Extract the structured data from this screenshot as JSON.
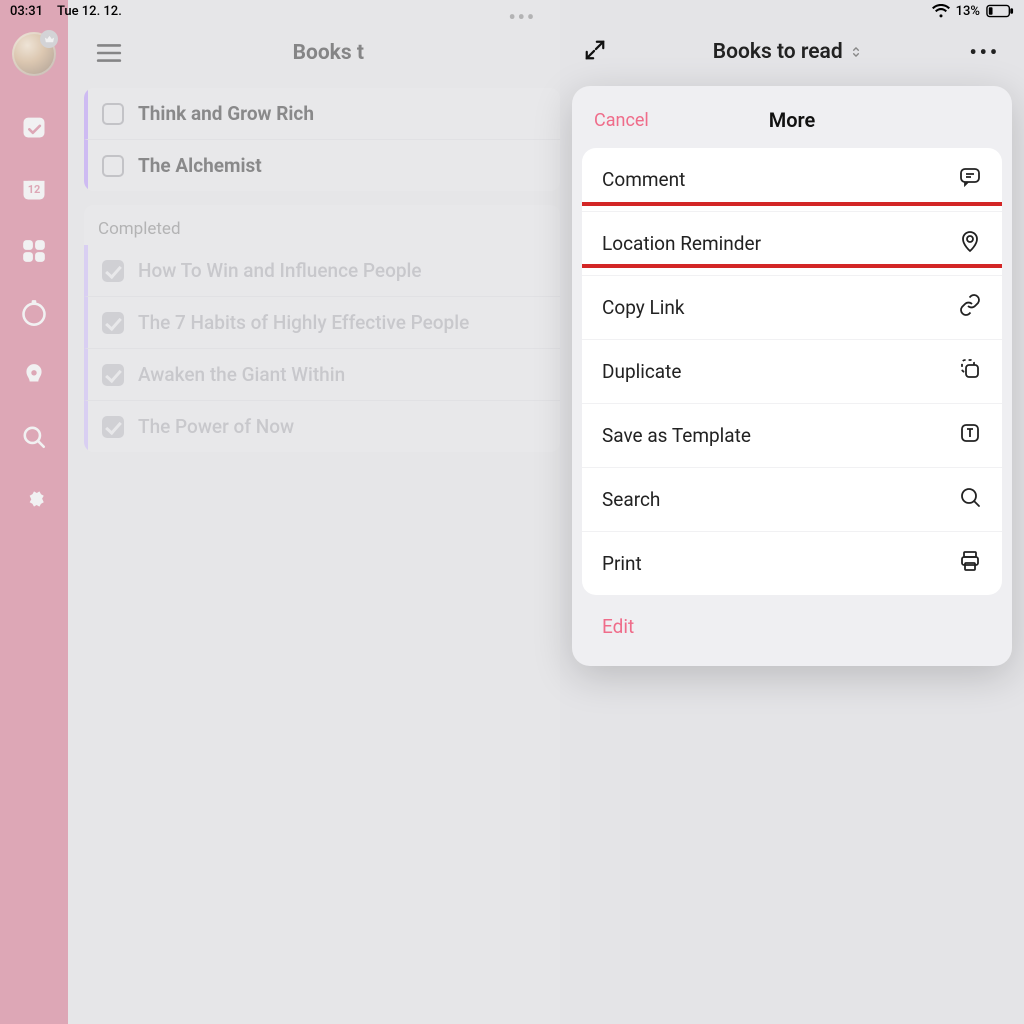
{
  "status": {
    "time": "03:31",
    "date": "Tue 12. 12.",
    "battery_pct": "13%"
  },
  "rail": {
    "calendar_day": "12"
  },
  "main": {
    "title_truncated": "Books t",
    "more_dots": "•••"
  },
  "tasks": {
    "active": [
      {
        "title": "Think and Grow Rich"
      },
      {
        "title": "The Alchemist"
      }
    ],
    "completed_label": "Completed",
    "completed": [
      {
        "title": "How To Win and Influence People"
      },
      {
        "title": "The 7 Habits of Highly Effective People"
      },
      {
        "title": "Awaken the Giant Within"
      },
      {
        "title": "The Power of Now"
      }
    ]
  },
  "side": {
    "title": "Books to read",
    "dots": "•••"
  },
  "sheet": {
    "cancel": "Cancel",
    "title": "More",
    "rows": [
      {
        "label": "Comment"
      },
      {
        "label": "Location Reminder"
      },
      {
        "label": "Copy Link"
      },
      {
        "label": "Duplicate"
      },
      {
        "label": "Save as Template"
      },
      {
        "label": "Search"
      },
      {
        "label": "Print"
      }
    ],
    "edit": "Edit"
  },
  "highlight_row_index": 1
}
